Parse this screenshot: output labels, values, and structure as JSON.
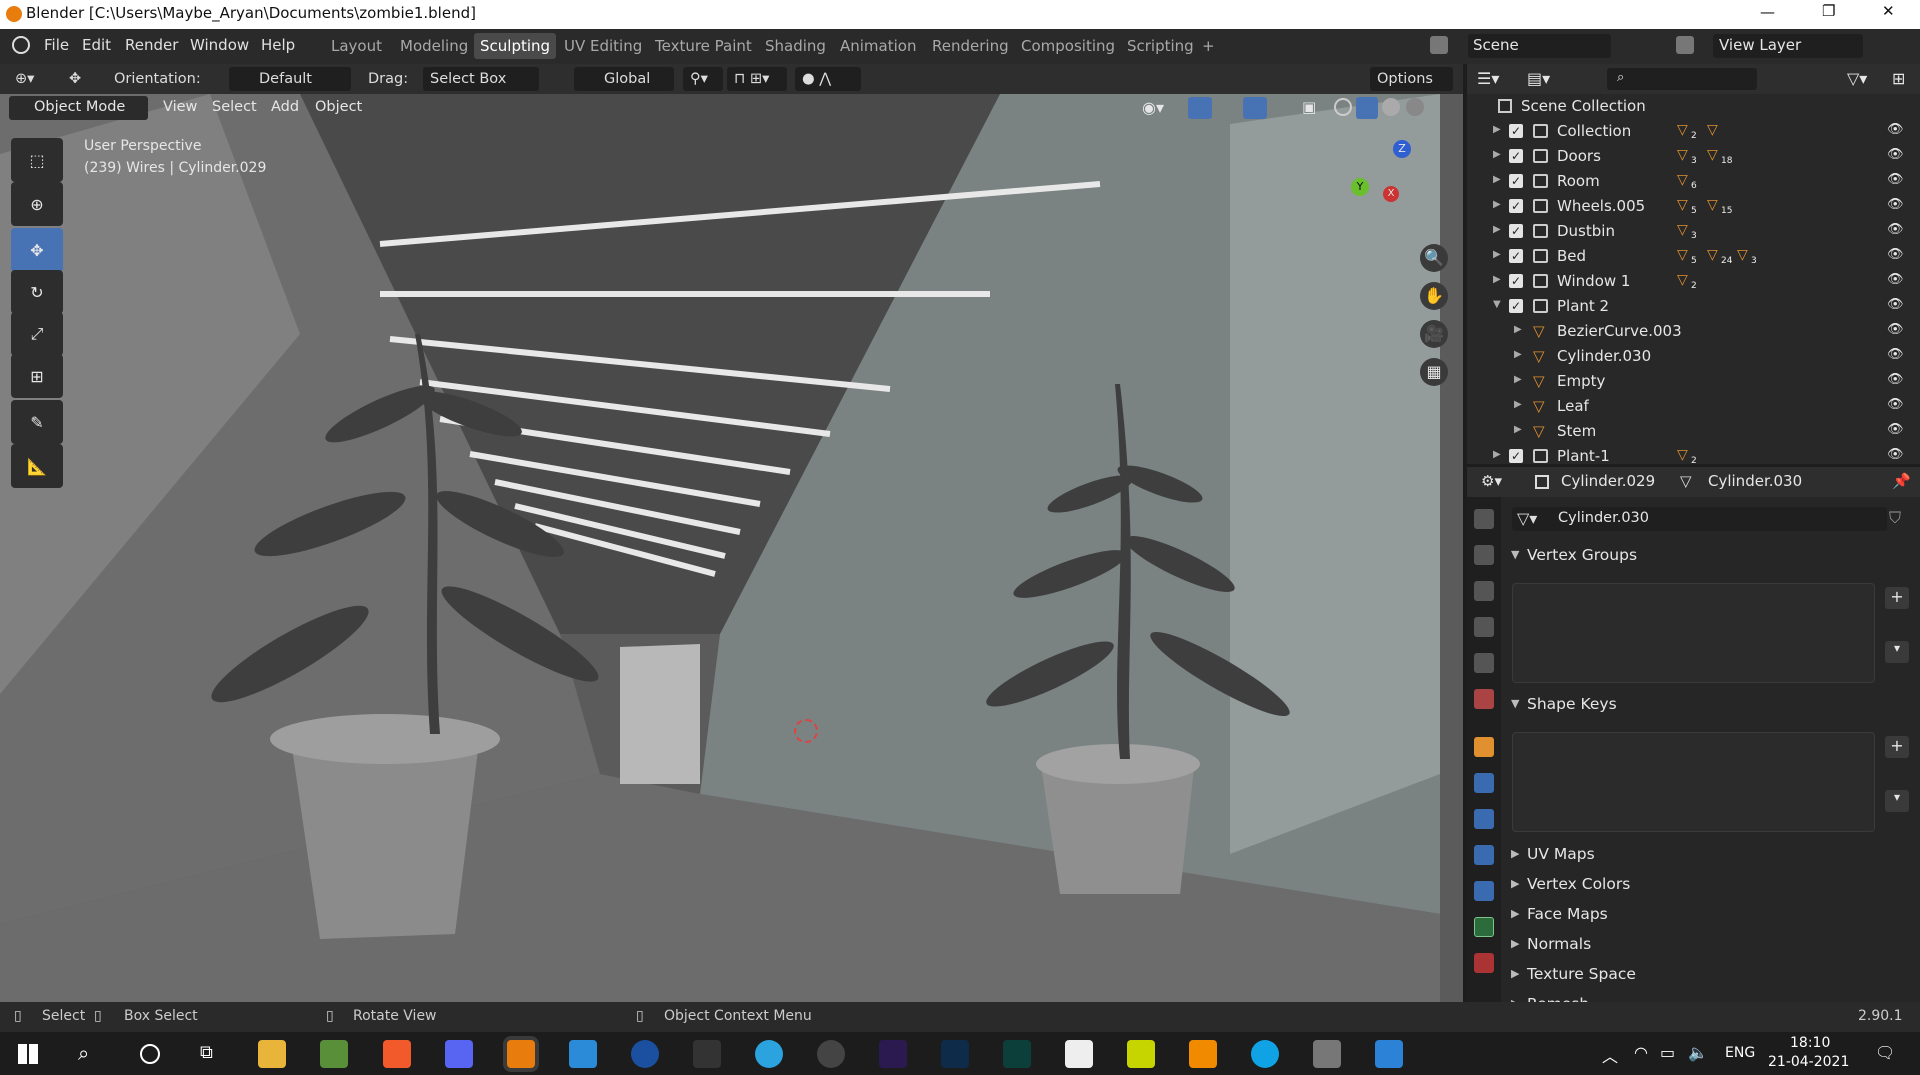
{
  "title": "Blender [C:\\Users\\Maybe_Aryan\\Documents\\zombie1.blend]",
  "menu": [
    "File",
    "Edit",
    "Render",
    "Window",
    "Help"
  ],
  "workspaces": [
    "Layout",
    "Modeling",
    "Sculpting",
    "UV Editing",
    "Texture Paint",
    "Shading",
    "Animation",
    "Rendering",
    "Compositing",
    "Scripting"
  ],
  "active_workspace": "Sculpting",
  "scene": {
    "label": "Scene",
    "view_layer": "View Layer"
  },
  "header": {
    "orientation_label": "Orientation:",
    "orientation_value": "Default",
    "drag_label": "Drag:",
    "drag_value": "Select Box",
    "transform": "Global",
    "options": "Options"
  },
  "viewport": {
    "mode": "Object Mode",
    "menus": [
      "View",
      "Select",
      "Add",
      "Object"
    ],
    "perspective": "User Perspective",
    "info": "(239) Wires | Cylinder.029",
    "axes": {
      "x": "X",
      "y": "Y",
      "z": "Z"
    }
  },
  "outliner": {
    "root": "Scene Collection",
    "rows": [
      {
        "name": "Collection",
        "counts": [
          "2",
          ""
        ]
      },
      {
        "name": "Doors",
        "counts": [
          "3",
          "18"
        ]
      },
      {
        "name": "Room",
        "counts": [
          "6"
        ]
      },
      {
        "name": "Wheels.005",
        "counts": [
          "5",
          "15"
        ]
      },
      {
        "name": "Dustbin",
        "counts": [
          "3"
        ]
      },
      {
        "name": "Bed",
        "counts": [
          "5",
          "24",
          "3"
        ]
      },
      {
        "name": "Window 1",
        "counts": [
          "2"
        ]
      },
      {
        "name": "Plant 2",
        "counts": []
      },
      {
        "name": "BezierCurve.003",
        "counts": []
      },
      {
        "name": "Cylinder.030",
        "counts": []
      },
      {
        "name": "Empty",
        "counts": []
      },
      {
        "name": "Leaf",
        "counts": []
      },
      {
        "name": "Stem",
        "counts": []
      },
      {
        "name": "Plant-1",
        "counts": [
          "2"
        ]
      }
    ]
  },
  "properties": {
    "object": "Cylinder.029",
    "mesh": "Cylinder.030",
    "datablock": "Cylinder.030",
    "panels": [
      "Vertex Groups",
      "Shape Keys",
      "UV Maps",
      "Vertex Colors",
      "Face Maps",
      "Normals",
      "Texture Space",
      "Remesh"
    ]
  },
  "status": {
    "select": "Select",
    "box_select": "Box Select",
    "rotate": "Rotate View",
    "context": "Object Context Menu",
    "version": "2.90.1"
  },
  "tray": {
    "lang": "ENG",
    "time": "18:10",
    "date": "21-04-2021"
  },
  "colors": {
    "accent": "#4772b3",
    "orange": "#e0902f",
    "green": "#7ec58c"
  }
}
